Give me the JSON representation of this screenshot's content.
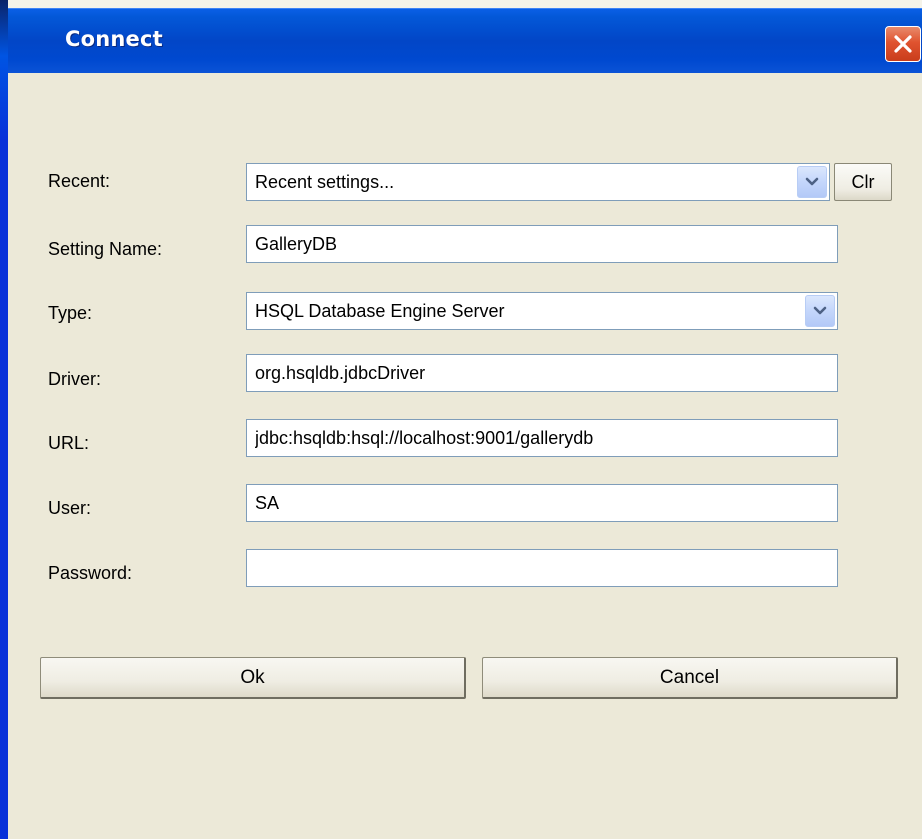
{
  "window": {
    "title": "Connect"
  },
  "form": {
    "recent": {
      "label": "Recent:",
      "value": "Recent settings...",
      "clear_label": "Clr"
    },
    "setting_name": {
      "label": "Setting Name:",
      "value": "GalleryDB"
    },
    "type": {
      "label": "Type:",
      "value": "HSQL Database Engine Server"
    },
    "driver": {
      "label": "Driver:",
      "value": "org.hsqldb.jdbcDriver"
    },
    "url": {
      "label": "URL:",
      "value": "jdbc:hsqldb:hsql://localhost:9001/gallerydb"
    },
    "user": {
      "label": "User:",
      "value": "SA"
    },
    "password": {
      "label": "Password:",
      "value": ""
    }
  },
  "buttons": {
    "ok": "Ok",
    "cancel": "Cancel"
  },
  "colors": {
    "titlebar": "#0246c7",
    "dialog_background": "#ece9d8",
    "close_button": "#e0532f",
    "field_border": "#7f9db9"
  },
  "icons": {
    "close": "close-icon",
    "dropdown": "chevron-down-icon"
  }
}
